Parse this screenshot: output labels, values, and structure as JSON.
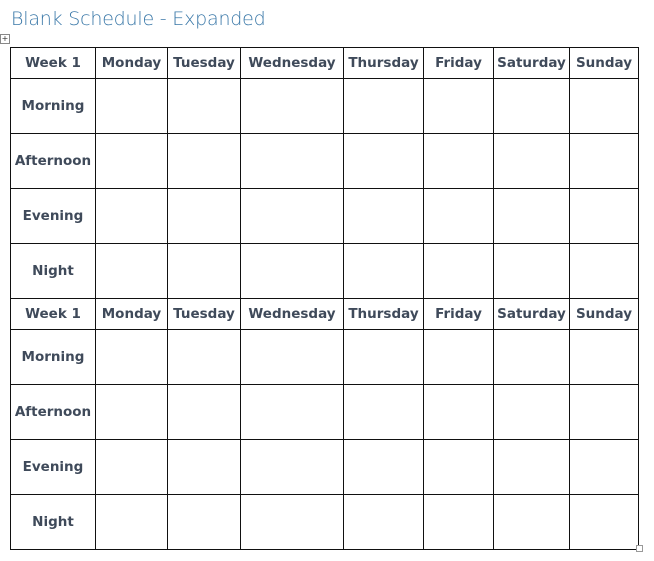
{
  "document": {
    "title": "Blank Schedule - Expanded"
  },
  "schedule": {
    "blocks": [
      {
        "header": [
          "Week 1",
          "Monday",
          "Tuesday",
          "Wednesday",
          "Thursday",
          "Friday",
          "Saturday",
          "Sunday"
        ],
        "rows": [
          "Morning",
          "Afternoon",
          "Evening",
          "Night"
        ]
      },
      {
        "header": [
          "Week 1",
          "Monday",
          "Tuesday",
          "Wednesday",
          "Thursday",
          "Friday",
          "Saturday",
          "Sunday"
        ],
        "rows": [
          "Morning",
          "Afternoon",
          "Evening",
          "Night"
        ]
      }
    ]
  },
  "icons": {
    "move_handle": "move-icon",
    "resize_handle": "resize-icon"
  }
}
